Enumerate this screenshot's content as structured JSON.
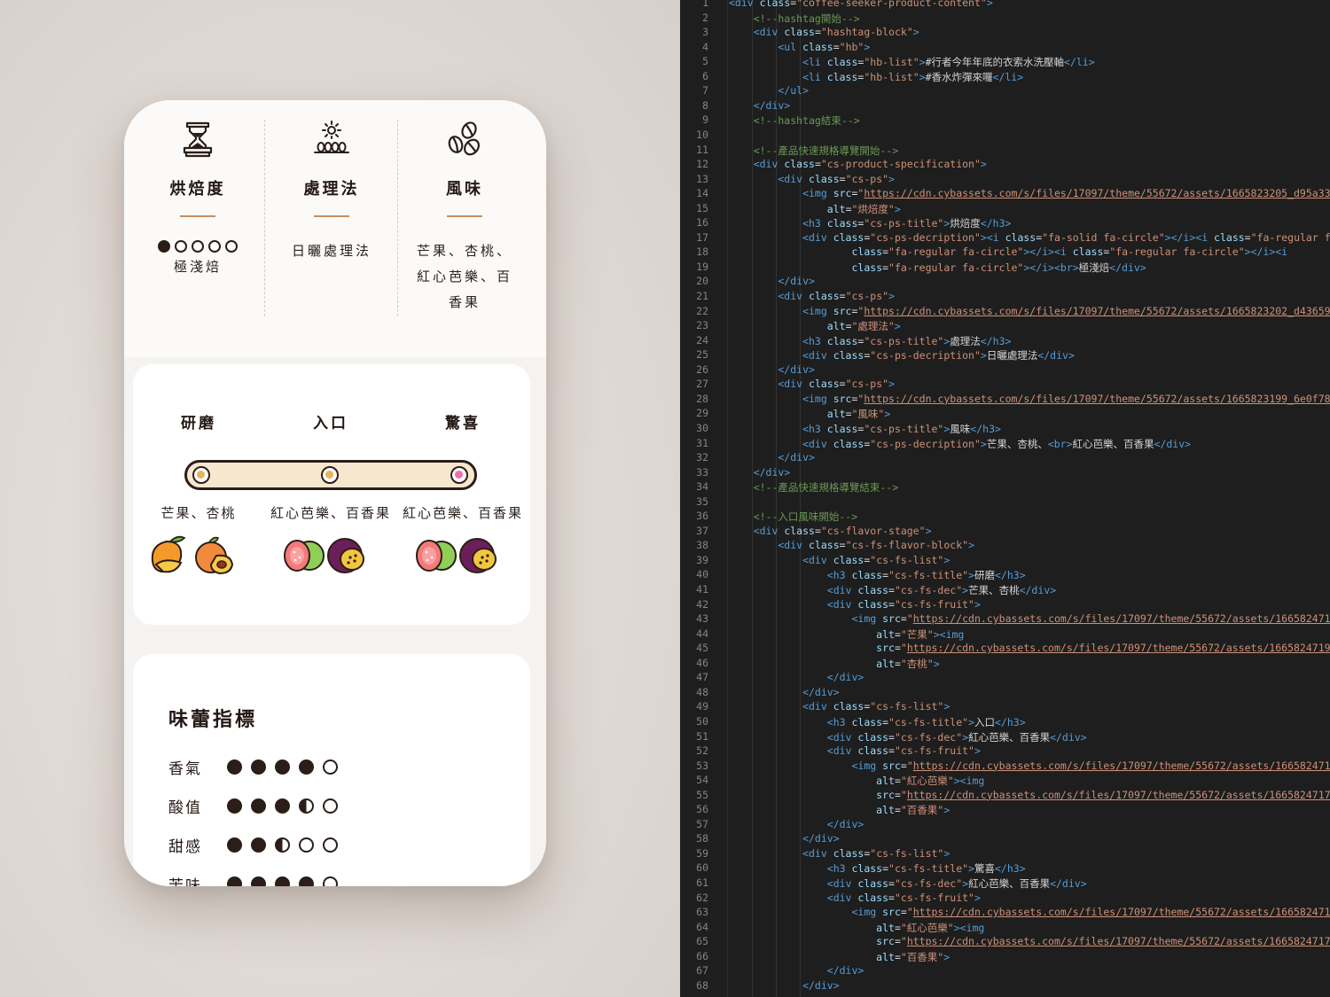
{
  "spec": [
    {
      "icon": "roast-hourglass-icon",
      "title": "烘焙度",
      "level": 1,
      "max": 5,
      "desc": "極淺焙"
    },
    {
      "icon": "sun-process-icon",
      "title": "處理法",
      "desc": "日曬處理法"
    },
    {
      "icon": "coffee-beans-icon",
      "title": "風味",
      "desc_line1": "芒果、杏桃、",
      "desc_line2": "紅心芭樂、百",
      "desc_line3": "香果"
    }
  ],
  "flavor_stage": [
    {
      "title": "研磨",
      "desc": "芒果、杏桃",
      "fruits": [
        "mango-icon",
        "apricot-icon"
      ],
      "knob_color": "#e8b45a"
    },
    {
      "title": "入口",
      "desc": "紅心芭樂、百香果",
      "fruits": [
        "guava-icon",
        "passion-fruit-icon"
      ],
      "knob_color": "#e8b45a"
    },
    {
      "title": "驚喜",
      "desc": "紅心芭樂、百香果",
      "fruits": [
        "guava-icon",
        "passion-fruit-icon"
      ],
      "knob_color": "#ef6fa6"
    }
  ],
  "taste": {
    "title": "味蕾指標",
    "rows": [
      {
        "label": "香氣",
        "value": 4,
        "max": 5
      },
      {
        "label": "酸值",
        "value": 3.5,
        "max": 5
      },
      {
        "label": "甜感",
        "value": 2.5,
        "max": 5
      },
      {
        "label": "苦味",
        "value": 4,
        "max": 5
      }
    ]
  },
  "colors": {
    "accent": "#c68f5d",
    "dark": "#2b1e18",
    "track": "#f7e7cf",
    "editor_bg": "#1e1e1e"
  },
  "code_lines": [
    [
      [
        "t-tag",
        "<div "
      ],
      [
        "t-attr",
        "class"
      ],
      [
        "t-txt",
        "="
      ],
      [
        "t-str",
        "\"coffee-seeker-product-content\""
      ],
      [
        "t-tag",
        ">"
      ]
    ],
    [
      [
        "t-com",
        "    <!--hashtag開始-->"
      ]
    ],
    [
      [
        "t-tag",
        "    <div "
      ],
      [
        "t-attr",
        "class"
      ],
      [
        "t-txt",
        "="
      ],
      [
        "t-str",
        "\"hashtag-block\""
      ],
      [
        "t-tag",
        ">"
      ]
    ],
    [
      [
        "t-tag",
        "        <ul "
      ],
      [
        "t-attr",
        "class"
      ],
      [
        "t-txt",
        "="
      ],
      [
        "t-str",
        "\"hb\""
      ],
      [
        "t-tag",
        ">"
      ]
    ],
    [
      [
        "t-tag",
        "            <li "
      ],
      [
        "t-attr",
        "class"
      ],
      [
        "t-txt",
        "="
      ],
      [
        "t-str",
        "\"hb-list\""
      ],
      [
        "t-tag",
        ">"
      ],
      [
        "t-txt",
        "#行者今年年底的衣索水洗壓軸"
      ],
      [
        "t-tag",
        "</li>"
      ]
    ],
    [
      [
        "t-tag",
        "            <li "
      ],
      [
        "t-attr",
        "class"
      ],
      [
        "t-txt",
        "="
      ],
      [
        "t-str",
        "\"hb-list\""
      ],
      [
        "t-tag",
        ">"
      ],
      [
        "t-txt",
        "#香水炸彈來囉"
      ],
      [
        "t-tag",
        "</li>"
      ]
    ],
    [
      [
        "t-tag",
        "        </ul>"
      ]
    ],
    [
      [
        "t-tag",
        "    </div>"
      ]
    ],
    [
      [
        "t-com",
        "    <!--hashtag結束-->"
      ]
    ],
    [],
    [
      [
        "t-com",
        "    <!--產品快速規格導覽開始-->"
      ]
    ],
    [
      [
        "t-tag",
        "    <div "
      ],
      [
        "t-attr",
        "class"
      ],
      [
        "t-txt",
        "="
      ],
      [
        "t-str",
        "\"cs-product-specification\""
      ],
      [
        "t-tag",
        ">"
      ]
    ],
    [
      [
        "t-tag",
        "        <div "
      ],
      [
        "t-attr",
        "class"
      ],
      [
        "t-txt",
        "="
      ],
      [
        "t-str",
        "\"cs-ps\""
      ],
      [
        "t-tag",
        ">"
      ]
    ],
    [
      [
        "t-tag",
        "            <img "
      ],
      [
        "t-attr",
        "src"
      ],
      [
        "t-txt",
        "="
      ],
      [
        "t-str",
        "\""
      ],
      [
        "t-url",
        "https://cdn.cybassets.com/s/files/17097/theme/55672/assets/1665823205_d95a333f_"
      ]
    ],
    [
      [
        "t-attr",
        "                alt"
      ],
      [
        "t-txt",
        "="
      ],
      [
        "t-str",
        "\"烘焙度\""
      ],
      [
        "t-tag",
        ">"
      ]
    ],
    [
      [
        "t-tag",
        "            <h3 "
      ],
      [
        "t-attr",
        "class"
      ],
      [
        "t-txt",
        "="
      ],
      [
        "t-str",
        "\"cs-ps-title\""
      ],
      [
        "t-tag",
        ">"
      ],
      [
        "t-txt",
        "烘焙度"
      ],
      [
        "t-tag",
        "</h3>"
      ]
    ],
    [
      [
        "t-tag",
        "            <div "
      ],
      [
        "t-attr",
        "class"
      ],
      [
        "t-txt",
        "="
      ],
      [
        "t-str",
        "\"cs-ps-decription\""
      ],
      [
        "t-tag",
        ">"
      ],
      [
        "t-tag",
        "<i "
      ],
      [
        "t-attr",
        "class"
      ],
      [
        "t-txt",
        "="
      ],
      [
        "t-str",
        "\"fa-solid fa-circle\""
      ],
      [
        "t-tag",
        "></i><i "
      ],
      [
        "t-attr",
        "class"
      ],
      [
        "t-txt",
        "="
      ],
      [
        "t-str",
        "\"fa-regular fa-c"
      ]
    ],
    [
      [
        "t-attr",
        "                    class"
      ],
      [
        "t-txt",
        "="
      ],
      [
        "t-str",
        "\"fa-regular fa-circle\""
      ],
      [
        "t-tag",
        "></i><i "
      ],
      [
        "t-attr",
        "class"
      ],
      [
        "t-txt",
        "="
      ],
      [
        "t-str",
        "\"fa-regular fa-circle\""
      ],
      [
        "t-tag",
        "></i><i"
      ]
    ],
    [
      [
        "t-attr",
        "                    class"
      ],
      [
        "t-txt",
        "="
      ],
      [
        "t-str",
        "\"fa-regular fa-circle\""
      ],
      [
        "t-tag",
        "></i><br>"
      ],
      [
        "t-txt",
        "極淺焙"
      ],
      [
        "t-tag",
        "</div>"
      ]
    ],
    [
      [
        "t-tag",
        "        </div>"
      ]
    ],
    [
      [
        "t-tag",
        "        <div "
      ],
      [
        "t-attr",
        "class"
      ],
      [
        "t-txt",
        "="
      ],
      [
        "t-str",
        "\"cs-ps\""
      ],
      [
        "t-tag",
        ">"
      ]
    ],
    [
      [
        "t-tag",
        "            <img "
      ],
      [
        "t-attr",
        "src"
      ],
      [
        "t-txt",
        "="
      ],
      [
        "t-str",
        "\""
      ],
      [
        "t-url",
        "https://cdn.cybassets.com/s/files/17097/theme/55672/assets/1665823202_d43659f9_"
      ]
    ],
    [
      [
        "t-attr",
        "                alt"
      ],
      [
        "t-txt",
        "="
      ],
      [
        "t-str",
        "\"處理法\""
      ],
      [
        "t-tag",
        ">"
      ]
    ],
    [
      [
        "t-tag",
        "            <h3 "
      ],
      [
        "t-attr",
        "class"
      ],
      [
        "t-txt",
        "="
      ],
      [
        "t-str",
        "\"cs-ps-title\""
      ],
      [
        "t-tag",
        ">"
      ],
      [
        "t-txt",
        "處理法"
      ],
      [
        "t-tag",
        "</h3>"
      ]
    ],
    [
      [
        "t-tag",
        "            <div "
      ],
      [
        "t-attr",
        "class"
      ],
      [
        "t-txt",
        "="
      ],
      [
        "t-str",
        "\"cs-ps-decription\""
      ],
      [
        "t-tag",
        ">"
      ],
      [
        "t-txt",
        "日曬處理法"
      ],
      [
        "t-tag",
        "</div>"
      ]
    ],
    [
      [
        "t-tag",
        "        </div>"
      ]
    ],
    [
      [
        "t-tag",
        "        <div "
      ],
      [
        "t-attr",
        "class"
      ],
      [
        "t-txt",
        "="
      ],
      [
        "t-str",
        "\"cs-ps\""
      ],
      [
        "t-tag",
        ">"
      ]
    ],
    [
      [
        "t-tag",
        "            <img "
      ],
      [
        "t-attr",
        "src"
      ],
      [
        "t-txt",
        "="
      ],
      [
        "t-str",
        "\""
      ],
      [
        "t-url",
        "https://cdn.cybassets.com/s/files/17097/theme/55672/assets/1665823199_6e0f7802_"
      ]
    ],
    [
      [
        "t-attr",
        "                alt"
      ],
      [
        "t-txt",
        "="
      ],
      [
        "t-str",
        "\"風味\""
      ],
      [
        "t-tag",
        ">"
      ]
    ],
    [
      [
        "t-tag",
        "            <h3 "
      ],
      [
        "t-attr",
        "class"
      ],
      [
        "t-txt",
        "="
      ],
      [
        "t-str",
        "\"cs-ps-title\""
      ],
      [
        "t-tag",
        ">"
      ],
      [
        "t-txt",
        "風味"
      ],
      [
        "t-tag",
        "</h3>"
      ]
    ],
    [
      [
        "t-tag",
        "            <div "
      ],
      [
        "t-attr",
        "class"
      ],
      [
        "t-txt",
        "="
      ],
      [
        "t-str",
        "\"cs-ps-decription\""
      ],
      [
        "t-tag",
        ">"
      ],
      [
        "t-txt",
        "芒果、杏桃、"
      ],
      [
        "t-tag",
        "<br>"
      ],
      [
        "t-txt",
        "紅心芭樂、百香果"
      ],
      [
        "t-tag",
        "</div>"
      ]
    ],
    [
      [
        "t-tag",
        "        </div>"
      ]
    ],
    [
      [
        "t-tag",
        "    </div>"
      ]
    ],
    [
      [
        "t-com",
        "    <!--產品快速規格導覽結束-->"
      ]
    ],
    [],
    [
      [
        "t-com",
        "    <!--入口風味開始-->"
      ]
    ],
    [
      [
        "t-tag",
        "    <div "
      ],
      [
        "t-attr",
        "class"
      ],
      [
        "t-txt",
        "="
      ],
      [
        "t-str",
        "\"cs-flavor-stage\""
      ],
      [
        "t-tag",
        ">"
      ]
    ],
    [
      [
        "t-tag",
        "        <div "
      ],
      [
        "t-attr",
        "class"
      ],
      [
        "t-txt",
        "="
      ],
      [
        "t-str",
        "\"cs-fs-flavor-block\""
      ],
      [
        "t-tag",
        ">"
      ]
    ],
    [
      [
        "t-tag",
        "            <div "
      ],
      [
        "t-attr",
        "class"
      ],
      [
        "t-txt",
        "="
      ],
      [
        "t-str",
        "\"cs-fs-list\""
      ],
      [
        "t-tag",
        ">"
      ]
    ],
    [
      [
        "t-tag",
        "                <h3 "
      ],
      [
        "t-attr",
        "class"
      ],
      [
        "t-txt",
        "="
      ],
      [
        "t-str",
        "\"cs-fs-title\""
      ],
      [
        "t-tag",
        ">"
      ],
      [
        "t-txt",
        "研磨"
      ],
      [
        "t-tag",
        "</h3>"
      ]
    ],
    [
      [
        "t-tag",
        "                <div "
      ],
      [
        "t-attr",
        "class"
      ],
      [
        "t-txt",
        "="
      ],
      [
        "t-str",
        "\"cs-fs-dec\""
      ],
      [
        "t-tag",
        ">"
      ],
      [
        "t-txt",
        "芒果、杏桃"
      ],
      [
        "t-tag",
        "</div>"
      ]
    ],
    [
      [
        "t-tag",
        "                <div "
      ],
      [
        "t-attr",
        "class"
      ],
      [
        "t-txt",
        "="
      ],
      [
        "t-str",
        "\"cs-fs-fruit\""
      ],
      [
        "t-tag",
        ">"
      ]
    ],
    [
      [
        "t-tag",
        "                    <img "
      ],
      [
        "t-attr",
        "src"
      ],
      [
        "t-txt",
        "="
      ],
      [
        "t-str",
        "\""
      ],
      [
        "t-url",
        "https://cdn.cybassets.com/s/files/17097/theme/55672/assets/1665824715_8"
      ]
    ],
    [
      [
        "t-attr",
        "                        alt"
      ],
      [
        "t-txt",
        "="
      ],
      [
        "t-str",
        "\"芒果\""
      ],
      [
        "t-tag",
        "><img"
      ]
    ],
    [
      [
        "t-attr",
        "                        src"
      ],
      [
        "t-txt",
        "="
      ],
      [
        "t-str",
        "\""
      ],
      [
        "t-url",
        "https://cdn.cybassets.com/s/files/17097/theme/55672/assets/1665824719_54"
      ]
    ],
    [
      [
        "t-attr",
        "                        alt"
      ],
      [
        "t-txt",
        "="
      ],
      [
        "t-str",
        "\"杏桃\""
      ],
      [
        "t-tag",
        ">"
      ]
    ],
    [
      [
        "t-tag",
        "                </div>"
      ]
    ],
    [
      [
        "t-tag",
        "            </div>"
      ]
    ],
    [
      [
        "t-tag",
        "            <div "
      ],
      [
        "t-attr",
        "class"
      ],
      [
        "t-txt",
        "="
      ],
      [
        "t-str",
        "\"cs-fs-list\""
      ],
      [
        "t-tag",
        ">"
      ]
    ],
    [
      [
        "t-tag",
        "                <h3 "
      ],
      [
        "t-attr",
        "class"
      ],
      [
        "t-txt",
        "="
      ],
      [
        "t-str",
        "\"cs-fs-title\""
      ],
      [
        "t-tag",
        ">"
      ],
      [
        "t-txt",
        "入口"
      ],
      [
        "t-tag",
        "</h3>"
      ]
    ],
    [
      [
        "t-tag",
        "                <div "
      ],
      [
        "t-attr",
        "class"
      ],
      [
        "t-txt",
        "="
      ],
      [
        "t-str",
        "\"cs-fs-dec\""
      ],
      [
        "t-tag",
        ">"
      ],
      [
        "t-txt",
        "紅心芭樂、百香果"
      ],
      [
        "t-tag",
        "</div>"
      ]
    ],
    [
      [
        "t-tag",
        "                <div "
      ],
      [
        "t-attr",
        "class"
      ],
      [
        "t-txt",
        "="
      ],
      [
        "t-str",
        "\"cs-fs-fruit\""
      ],
      [
        "t-tag",
        ">"
      ]
    ],
    [
      [
        "t-tag",
        "                    <img "
      ],
      [
        "t-attr",
        "src"
      ],
      [
        "t-txt",
        "="
      ],
      [
        "t-str",
        "\""
      ],
      [
        "t-url",
        "https://cdn.cybassets.com/s/files/17097/theme/55672/assets/1665824712_c"
      ]
    ],
    [
      [
        "t-attr",
        "                        alt"
      ],
      [
        "t-txt",
        "="
      ],
      [
        "t-str",
        "\"紅心芭樂\""
      ],
      [
        "t-tag",
        "><img"
      ]
    ],
    [
      [
        "t-attr",
        "                        src"
      ],
      [
        "t-txt",
        "="
      ],
      [
        "t-str",
        "\""
      ],
      [
        "t-url",
        "https://cdn.cybassets.com/s/files/17097/theme/55672/assets/1665824717_0e"
      ]
    ],
    [
      [
        "t-attr",
        "                        alt"
      ],
      [
        "t-txt",
        "="
      ],
      [
        "t-str",
        "\"百香果\""
      ],
      [
        "t-tag",
        ">"
      ]
    ],
    [
      [
        "t-tag",
        "                </div>"
      ]
    ],
    [
      [
        "t-tag",
        "            </div>"
      ]
    ],
    [
      [
        "t-tag",
        "            <div "
      ],
      [
        "t-attr",
        "class"
      ],
      [
        "t-txt",
        "="
      ],
      [
        "t-str",
        "\"cs-fs-list\""
      ],
      [
        "t-tag",
        ">"
      ]
    ],
    [
      [
        "t-tag",
        "                <h3 "
      ],
      [
        "t-attr",
        "class"
      ],
      [
        "t-txt",
        "="
      ],
      [
        "t-str",
        "\"cs-fs-title\""
      ],
      [
        "t-tag",
        ">"
      ],
      [
        "t-txt",
        "驚喜"
      ],
      [
        "t-tag",
        "</h3>"
      ]
    ],
    [
      [
        "t-tag",
        "                <div "
      ],
      [
        "t-attr",
        "class"
      ],
      [
        "t-txt",
        "="
      ],
      [
        "t-str",
        "\"cs-fs-dec\""
      ],
      [
        "t-tag",
        ">"
      ],
      [
        "t-txt",
        "紅心芭樂、百香果"
      ],
      [
        "t-tag",
        "</div>"
      ]
    ],
    [
      [
        "t-tag",
        "                <div "
      ],
      [
        "t-attr",
        "class"
      ],
      [
        "t-txt",
        "="
      ],
      [
        "t-str",
        "\"cs-fs-fruit\""
      ],
      [
        "t-tag",
        ">"
      ]
    ],
    [
      [
        "t-tag",
        "                    <img "
      ],
      [
        "t-attr",
        "src"
      ],
      [
        "t-txt",
        "="
      ],
      [
        "t-str",
        "\""
      ],
      [
        "t-url",
        "https://cdn.cybassets.com/s/files/17097/theme/55672/assets/1665824712_c"
      ]
    ],
    [
      [
        "t-attr",
        "                        alt"
      ],
      [
        "t-txt",
        "="
      ],
      [
        "t-str",
        "\"紅心芭樂\""
      ],
      [
        "t-tag",
        "><img"
      ]
    ],
    [
      [
        "t-attr",
        "                        src"
      ],
      [
        "t-txt",
        "="
      ],
      [
        "t-str",
        "\""
      ],
      [
        "t-url",
        "https://cdn.cybassets.com/s/files/17097/theme/55672/assets/1665824717_0e"
      ]
    ],
    [
      [
        "t-attr",
        "                        alt"
      ],
      [
        "t-txt",
        "="
      ],
      [
        "t-str",
        "\"百香果\""
      ],
      [
        "t-tag",
        ">"
      ]
    ],
    [
      [
        "t-tag",
        "                </div>"
      ]
    ],
    [
      [
        "t-tag",
        "            </div>"
      ]
    ]
  ]
}
